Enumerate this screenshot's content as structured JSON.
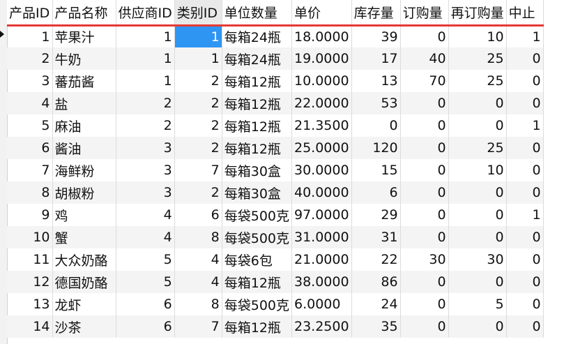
{
  "table": {
    "columns": [
      "产品ID",
      "产品名称",
      "供应商ID",
      "类别ID",
      "单位数量",
      "单价",
      "库存量",
      "订购量",
      "再订购量",
      "中止"
    ],
    "rows": [
      [
        "1",
        "苹果汁",
        "1",
        "1",
        "每箱24瓶",
        "18.0000",
        "39",
        "0",
        "10",
        "1"
      ],
      [
        "2",
        "牛奶",
        "1",
        "1",
        "每箱24瓶",
        "19.0000",
        "17",
        "40",
        "25",
        "0"
      ],
      [
        "3",
        "蕃茄酱",
        "1",
        "2",
        "每箱12瓶",
        "10.0000",
        "13",
        "70",
        "25",
        "0"
      ],
      [
        "4",
        "盐",
        "2",
        "2",
        "每箱12瓶",
        "22.0000",
        "53",
        "0",
        "0",
        "0"
      ],
      [
        "5",
        "麻油",
        "2",
        "2",
        "每箱12瓶",
        "21.3500",
        "0",
        "0",
        "0",
        "1"
      ],
      [
        "6",
        "酱油",
        "3",
        "2",
        "每箱12瓶",
        "25.0000",
        "120",
        "0",
        "25",
        "0"
      ],
      [
        "7",
        "海鲜粉",
        "3",
        "7",
        "每箱30盒",
        "30.0000",
        "15",
        "0",
        "10",
        "0"
      ],
      [
        "8",
        "胡椒粉",
        "3",
        "2",
        "每箱30盒",
        "40.0000",
        "6",
        "0",
        "0",
        "0"
      ],
      [
        "9",
        "鸡",
        "4",
        "6",
        "每袋500克",
        "97.0000",
        "29",
        "0",
        "0",
        "1"
      ],
      [
        "10",
        "蟹",
        "4",
        "8",
        "每袋500克",
        "31.0000",
        "31",
        "0",
        "0",
        "0"
      ],
      [
        "11",
        "大众奶酪",
        "5",
        "4",
        "每袋6包",
        "21.0000",
        "22",
        "30",
        "30",
        "0"
      ],
      [
        "12",
        "德国奶酪",
        "5",
        "4",
        "每箱12瓶",
        "38.0000",
        "86",
        "0",
        "0",
        "0"
      ],
      [
        "13",
        "龙虾",
        "6",
        "8",
        "每袋500克",
        "6.0000",
        "24",
        "0",
        "5",
        "0"
      ],
      [
        "14",
        "沙茶",
        "6",
        "7",
        "每箱12瓶",
        "23.2500",
        "35",
        "0",
        "0",
        "0"
      ]
    ],
    "selected_cell": {
      "row": 0,
      "column": 3
    }
  }
}
